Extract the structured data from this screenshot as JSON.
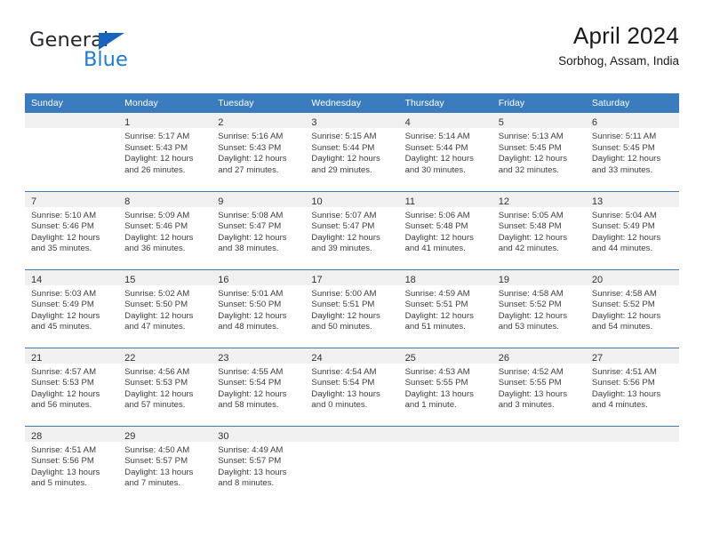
{
  "brand": {
    "name_part1": "General",
    "name_part2": "Blue",
    "accent_color": "#1c7cd6",
    "triangle_color": "#1565c0"
  },
  "header": {
    "month_title": "April 2024",
    "location": "Sorbhog, Assam, India"
  },
  "theme": {
    "header_blue": "#3a7cbe",
    "daynum_band": "#f0f0f0",
    "text": "#3d3d3d"
  },
  "weekday_headers": [
    "Sunday",
    "Monday",
    "Tuesday",
    "Wednesday",
    "Thursday",
    "Friday",
    "Saturday"
  ],
  "weeks": [
    [
      {
        "day": "",
        "lines": [
          "",
          "",
          "",
          ""
        ]
      },
      {
        "day": "1",
        "lines": [
          "Sunrise: 5:17 AM",
          "Sunset: 5:43 PM",
          "Daylight: 12 hours",
          "and 26 minutes."
        ]
      },
      {
        "day": "2",
        "lines": [
          "Sunrise: 5:16 AM",
          "Sunset: 5:43 PM",
          "Daylight: 12 hours",
          "and 27 minutes."
        ]
      },
      {
        "day": "3",
        "lines": [
          "Sunrise: 5:15 AM",
          "Sunset: 5:44 PM",
          "Daylight: 12 hours",
          "and 29 minutes."
        ]
      },
      {
        "day": "4",
        "lines": [
          "Sunrise: 5:14 AM",
          "Sunset: 5:44 PM",
          "Daylight: 12 hours",
          "and 30 minutes."
        ]
      },
      {
        "day": "5",
        "lines": [
          "Sunrise: 5:13 AM",
          "Sunset: 5:45 PM",
          "Daylight: 12 hours",
          "and 32 minutes."
        ]
      },
      {
        "day": "6",
        "lines": [
          "Sunrise: 5:11 AM",
          "Sunset: 5:45 PM",
          "Daylight: 12 hours",
          "and 33 minutes."
        ]
      }
    ],
    [
      {
        "day": "7",
        "lines": [
          "Sunrise: 5:10 AM",
          "Sunset: 5:46 PM",
          "Daylight: 12 hours",
          "and 35 minutes."
        ]
      },
      {
        "day": "8",
        "lines": [
          "Sunrise: 5:09 AM",
          "Sunset: 5:46 PM",
          "Daylight: 12 hours",
          "and 36 minutes."
        ]
      },
      {
        "day": "9",
        "lines": [
          "Sunrise: 5:08 AM",
          "Sunset: 5:47 PM",
          "Daylight: 12 hours",
          "and 38 minutes."
        ]
      },
      {
        "day": "10",
        "lines": [
          "Sunrise: 5:07 AM",
          "Sunset: 5:47 PM",
          "Daylight: 12 hours",
          "and 39 minutes."
        ]
      },
      {
        "day": "11",
        "lines": [
          "Sunrise: 5:06 AM",
          "Sunset: 5:48 PM",
          "Daylight: 12 hours",
          "and 41 minutes."
        ]
      },
      {
        "day": "12",
        "lines": [
          "Sunrise: 5:05 AM",
          "Sunset: 5:48 PM",
          "Daylight: 12 hours",
          "and 42 minutes."
        ]
      },
      {
        "day": "13",
        "lines": [
          "Sunrise: 5:04 AM",
          "Sunset: 5:49 PM",
          "Daylight: 12 hours",
          "and 44 minutes."
        ]
      }
    ],
    [
      {
        "day": "14",
        "lines": [
          "Sunrise: 5:03 AM",
          "Sunset: 5:49 PM",
          "Daylight: 12 hours",
          "and 45 minutes."
        ]
      },
      {
        "day": "15",
        "lines": [
          "Sunrise: 5:02 AM",
          "Sunset: 5:50 PM",
          "Daylight: 12 hours",
          "and 47 minutes."
        ]
      },
      {
        "day": "16",
        "lines": [
          "Sunrise: 5:01 AM",
          "Sunset: 5:50 PM",
          "Daylight: 12 hours",
          "and 48 minutes."
        ]
      },
      {
        "day": "17",
        "lines": [
          "Sunrise: 5:00 AM",
          "Sunset: 5:51 PM",
          "Daylight: 12 hours",
          "and 50 minutes."
        ]
      },
      {
        "day": "18",
        "lines": [
          "Sunrise: 4:59 AM",
          "Sunset: 5:51 PM",
          "Daylight: 12 hours",
          "and 51 minutes."
        ]
      },
      {
        "day": "19",
        "lines": [
          "Sunrise: 4:58 AM",
          "Sunset: 5:52 PM",
          "Daylight: 12 hours",
          "and 53 minutes."
        ]
      },
      {
        "day": "20",
        "lines": [
          "Sunrise: 4:58 AM",
          "Sunset: 5:52 PM",
          "Daylight: 12 hours",
          "and 54 minutes."
        ]
      }
    ],
    [
      {
        "day": "21",
        "lines": [
          "Sunrise: 4:57 AM",
          "Sunset: 5:53 PM",
          "Daylight: 12 hours",
          "and 56 minutes."
        ]
      },
      {
        "day": "22",
        "lines": [
          "Sunrise: 4:56 AM",
          "Sunset: 5:53 PM",
          "Daylight: 12 hours",
          "and 57 minutes."
        ]
      },
      {
        "day": "23",
        "lines": [
          "Sunrise: 4:55 AM",
          "Sunset: 5:54 PM",
          "Daylight: 12 hours",
          "and 58 minutes."
        ]
      },
      {
        "day": "24",
        "lines": [
          "Sunrise: 4:54 AM",
          "Sunset: 5:54 PM",
          "Daylight: 13 hours",
          "and 0 minutes."
        ]
      },
      {
        "day": "25",
        "lines": [
          "Sunrise: 4:53 AM",
          "Sunset: 5:55 PM",
          "Daylight: 13 hours",
          "and 1 minute."
        ]
      },
      {
        "day": "26",
        "lines": [
          "Sunrise: 4:52 AM",
          "Sunset: 5:55 PM",
          "Daylight: 13 hours",
          "and 3 minutes."
        ]
      },
      {
        "day": "27",
        "lines": [
          "Sunrise: 4:51 AM",
          "Sunset: 5:56 PM",
          "Daylight: 13 hours",
          "and 4 minutes."
        ]
      }
    ],
    [
      {
        "day": "28",
        "lines": [
          "Sunrise: 4:51 AM",
          "Sunset: 5:56 PM",
          "Daylight: 13 hours",
          "and 5 minutes."
        ]
      },
      {
        "day": "29",
        "lines": [
          "Sunrise: 4:50 AM",
          "Sunset: 5:57 PM",
          "Daylight: 13 hours",
          "and 7 minutes."
        ]
      },
      {
        "day": "30",
        "lines": [
          "Sunrise: 4:49 AM",
          "Sunset: 5:57 PM",
          "Daylight: 13 hours",
          "and 8 minutes."
        ]
      },
      {
        "day": "",
        "lines": [
          "",
          "",
          "",
          ""
        ]
      },
      {
        "day": "",
        "lines": [
          "",
          "",
          "",
          ""
        ]
      },
      {
        "day": "",
        "lines": [
          "",
          "",
          "",
          ""
        ]
      },
      {
        "day": "",
        "lines": [
          "",
          "",
          "",
          ""
        ]
      }
    ]
  ]
}
